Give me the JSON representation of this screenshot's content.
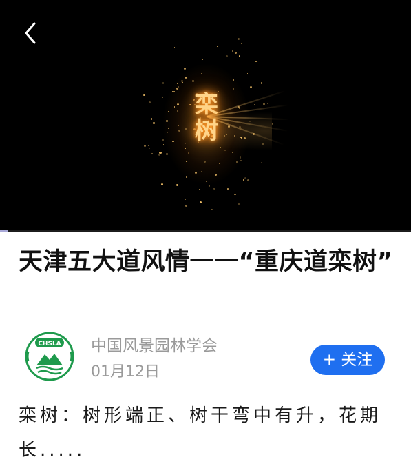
{
  "video": {
    "overlay_text": "栾\n树",
    "progress_fraction": 0.02,
    "back_icon": "chevron-left-icon",
    "glow_color": "#ffb040"
  },
  "article": {
    "title": "天津五大道风情一一“重庆道栾树”",
    "author": "中国风景园林学会",
    "date": "01月12日",
    "follow_label": "+ 关注",
    "summary": "栾树：树形端正、树干弯中有升，花期长.....",
    "logo_text": "CHSLA"
  },
  "colors": {
    "accent": "#1f6ff0",
    "logo_green": "#1e9a4c",
    "meta_gray": "#9a9a9a"
  }
}
